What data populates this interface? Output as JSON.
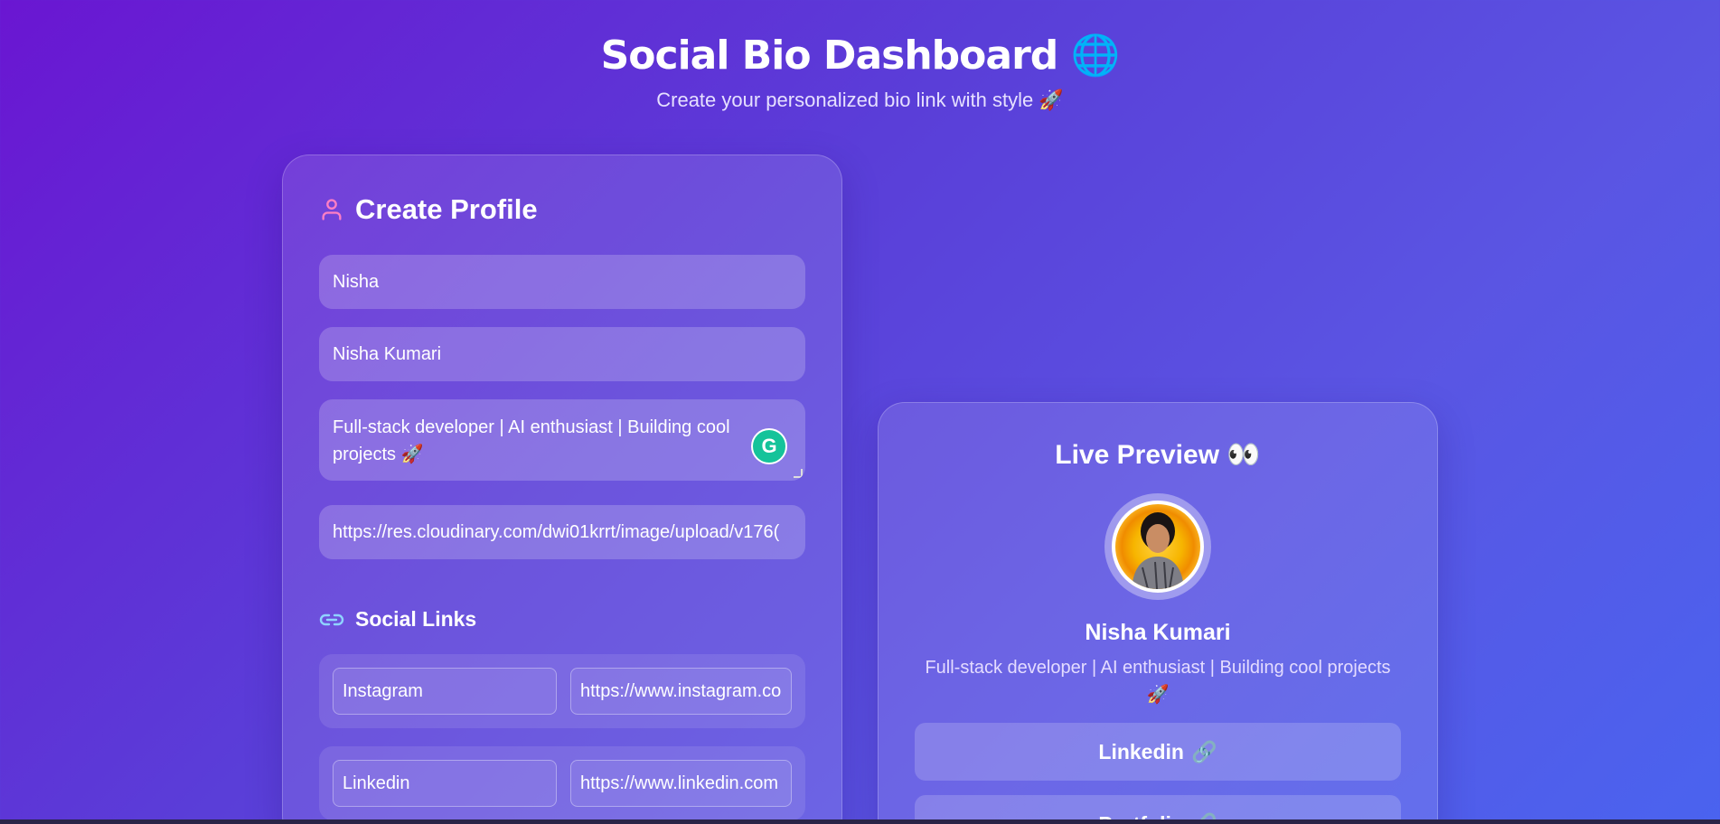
{
  "header": {
    "title": "Social Bio Dashboard 🌐",
    "subtitle": "Create your personalized bio link with style 🚀"
  },
  "form": {
    "title": "Create Profile",
    "username": "Nisha",
    "full_name": "Nisha Kumari",
    "bio": "Full-stack developer | AI enthusiast | Building cool projects 🚀",
    "image_url": "https://res.cloudinary.com/dwi01krrt/image/upload/v176(",
    "social_title": "Social Links",
    "links": [
      {
        "platform": "Instagram",
        "url": "https://www.instagram.co"
      },
      {
        "platform": "Linkedin",
        "url": "https://www.linkedin.com"
      }
    ]
  },
  "preview": {
    "title": "Live Preview 👀",
    "name": "Nisha Kumari",
    "bio": "Full-stack developer | AI enthusiast | Building cool projects 🚀",
    "links": [
      {
        "label": "Linkedin",
        "icon": "🔗"
      },
      {
        "label": "Portfolio",
        "icon": "🔗"
      }
    ]
  },
  "colors": {
    "user_icon": "#ff7fc4",
    "link_icon": "#8fd3ff",
    "grammarly": "#15c39a"
  },
  "icons": {
    "user": "user-icon",
    "link": "link-icon",
    "grammarly": "grammarly-icon"
  },
  "grammarly_glyph": "G"
}
